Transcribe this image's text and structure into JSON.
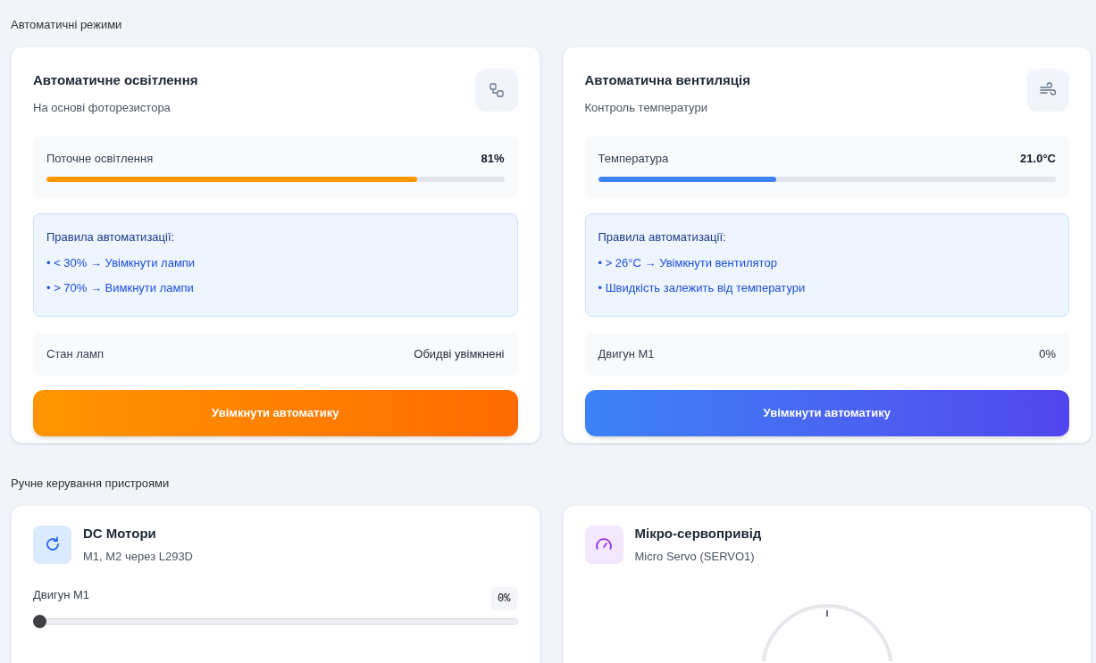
{
  "auto_section": {
    "title": "Автоматичні режими",
    "cards": [
      {
        "kind": "lighting",
        "title": "Автоматичне освітлення",
        "subtitle": "На основі фоторезистора",
        "sensor": {
          "label": "Поточне освітлення",
          "value": "81%",
          "level": 0.81
        },
        "rules": {
          "title": "Правила автоматизації:",
          "items": [
            "• < 30% → Увімкнути лампи",
            "• > 70% → Вимкнути лампи"
          ]
        },
        "status": {
          "label": "Стан ламп",
          "value": "Обидві увімкнені"
        },
        "button": "Увімкнути автоматику"
      },
      {
        "kind": "ventilation",
        "title": "Автоматична вентиляція",
        "subtitle": "Контроль температури",
        "sensor": {
          "label": "Температура",
          "value": "21.0°C",
          "level": 0.39
        },
        "rules": {
          "title": "Правила автоматизації:",
          "items": [
            "• > 26°C → Увімкнути вентилятор",
            "• Швидкість залежить від температури"
          ]
        },
        "status": {
          "label": "Двигун M1",
          "value": "0%"
        },
        "button": "Увімкнути автоматику"
      }
    ]
  },
  "manual_section": {
    "title": "Ручне керування пристроями",
    "cards": [
      {
        "kind": "motor",
        "title": "DC Мотори",
        "subtitle": "M1, M2 через L293D",
        "slider": {
          "label": "Двигун M1",
          "value": "0%",
          "level": 0
        }
      },
      {
        "kind": "servo",
        "title": "Мікро-сервопривід",
        "subtitle": "Micro Servo (SERVO1)"
      }
    ]
  }
}
